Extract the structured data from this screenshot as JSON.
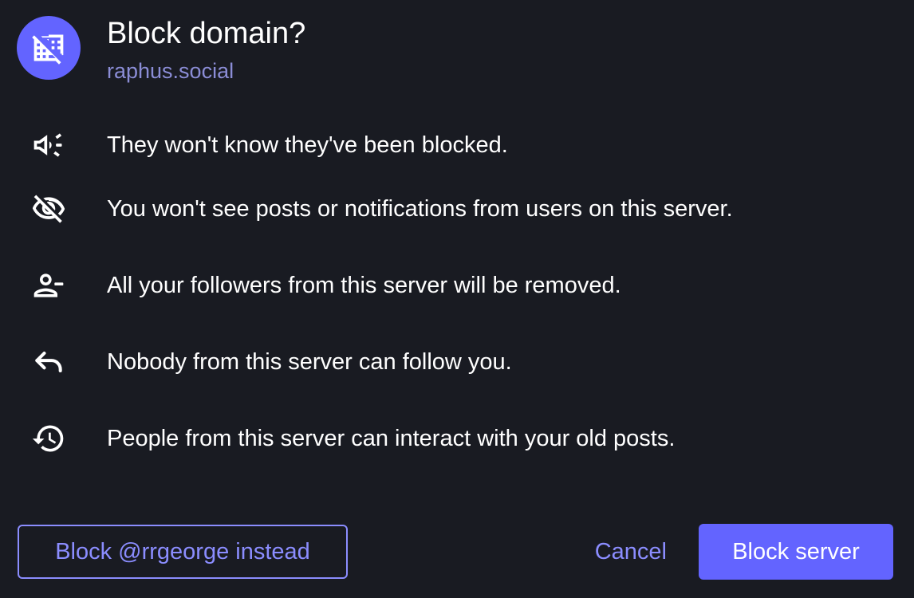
{
  "dialog": {
    "title": "Block domain?",
    "domain": "raphus.social",
    "avatar_icon": "domain-disabled-icon"
  },
  "consequences": [
    {
      "icon": "campaign-icon",
      "text": "They won't know they've been blocked."
    },
    {
      "icon": "visibility-off-icon",
      "text": "You won't see posts or notifications from users on this server."
    },
    {
      "icon": "person-remove-icon",
      "text": "All your followers from this server will be removed."
    },
    {
      "icon": "reply-icon",
      "text": "Nobody from this server can follow you."
    },
    {
      "icon": "history-icon",
      "text": "People from this server can interact with your old posts."
    }
  ],
  "actions": {
    "block_user_label": "Block @rrgeorge instead",
    "cancel_label": "Cancel",
    "block_server_label": "Block server"
  },
  "colors": {
    "background": "#191b22",
    "accent": "#6364ff",
    "accent_text": "#8b8dff",
    "subtitle": "#8b8dd6",
    "text": "#ffffff"
  }
}
